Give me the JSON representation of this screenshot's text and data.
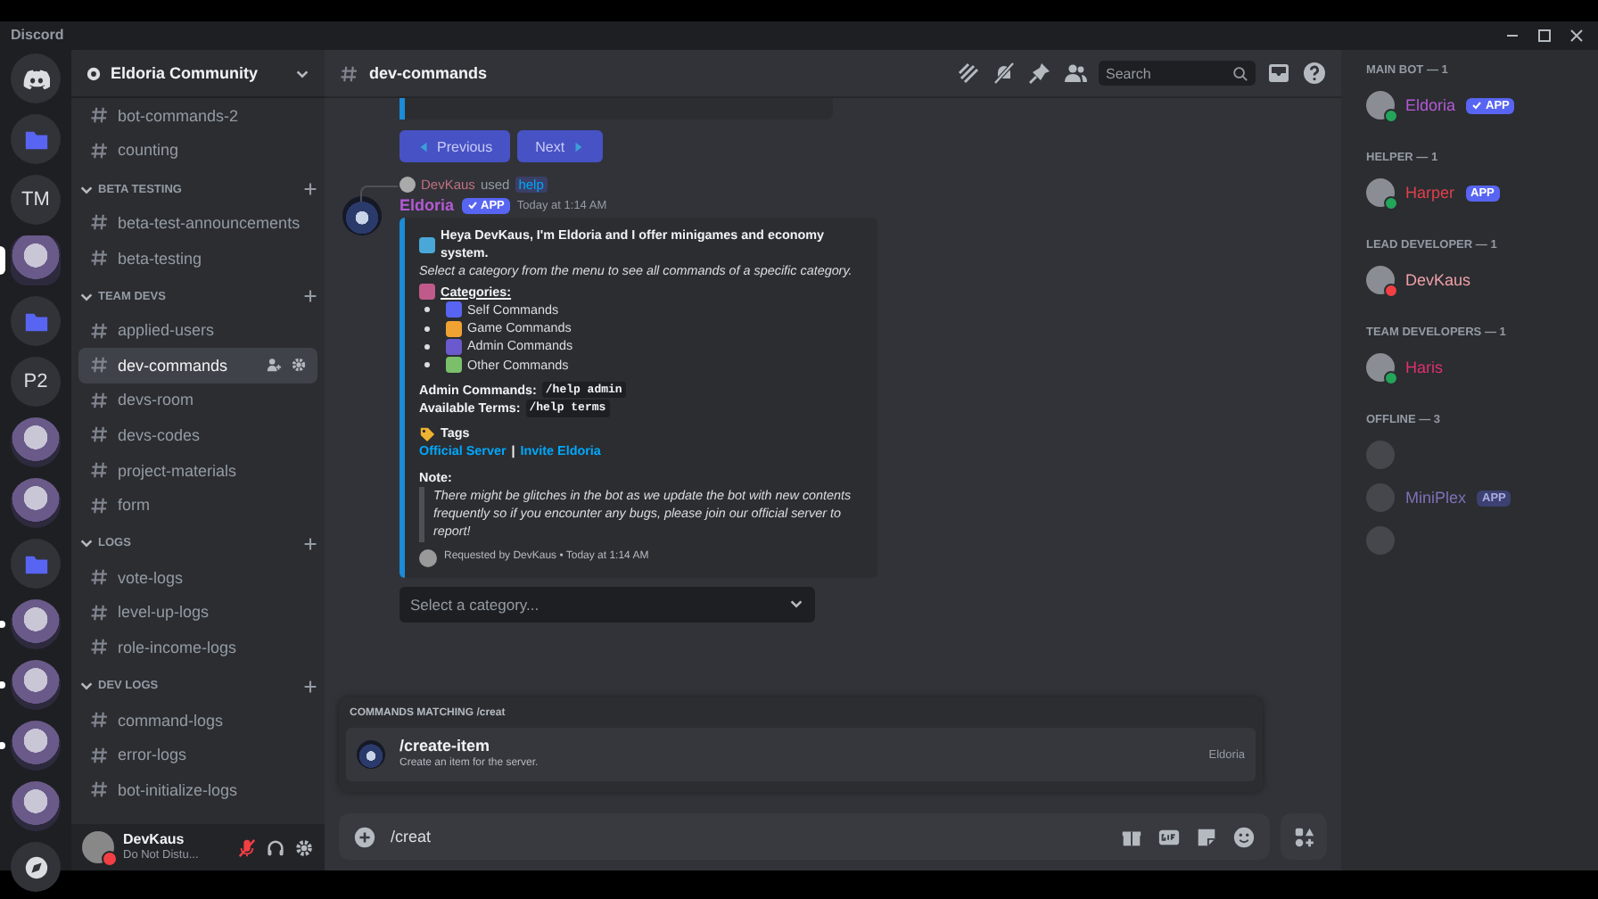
{
  "window": {
    "title": "Discord"
  },
  "servers": [
    {
      "kind": "home",
      "selected": false,
      "unread": false
    },
    {
      "kind": "folder",
      "selected": false,
      "unread": false
    },
    {
      "kind": "text",
      "label": "TM",
      "selected": false,
      "unread": false
    },
    {
      "kind": "avatar",
      "selected": true,
      "unread": false
    },
    {
      "kind": "folder",
      "selected": false,
      "unread": false
    },
    {
      "kind": "text",
      "label": "P2",
      "selected": false,
      "unread": false
    },
    {
      "kind": "avatar",
      "selected": false,
      "unread": false
    },
    {
      "kind": "avatar",
      "selected": false,
      "unread": false
    },
    {
      "kind": "folder",
      "selected": false,
      "unread": false
    },
    {
      "kind": "avatar",
      "selected": false,
      "unread": true
    },
    {
      "kind": "avatar",
      "selected": false,
      "unread": true
    },
    {
      "kind": "avatar",
      "selected": false,
      "unread": true
    },
    {
      "kind": "avatar",
      "selected": false,
      "unread": false
    },
    {
      "kind": "explore",
      "selected": false,
      "unread": false
    }
  ],
  "server": {
    "name": "Eldoria Community"
  },
  "channels": [
    {
      "kind": "channel",
      "name": "bot-commands-2",
      "selected": false
    },
    {
      "kind": "channel",
      "name": "counting",
      "selected": false
    },
    {
      "kind": "category",
      "name": "BETA TESTING",
      "children": [
        {
          "kind": "channel",
          "name": "beta-test-announcements",
          "selected": false
        },
        {
          "kind": "channel",
          "name": "beta-testing",
          "selected": false
        }
      ]
    },
    {
      "kind": "category",
      "name": "TEAM DEVS",
      "children": [
        {
          "kind": "channel",
          "name": "applied-users",
          "selected": false
        },
        {
          "kind": "channel",
          "name": "dev-commands",
          "selected": true
        },
        {
          "kind": "channel",
          "name": "devs-room",
          "selected": false
        },
        {
          "kind": "channel",
          "name": "devs-codes",
          "selected": false
        },
        {
          "kind": "channel",
          "name": "project-materials",
          "selected": false
        },
        {
          "kind": "channel",
          "name": "form",
          "selected": false
        }
      ]
    },
    {
      "kind": "category",
      "name": "LOGS",
      "children": [
        {
          "kind": "channel",
          "name": "vote-logs",
          "selected": false
        },
        {
          "kind": "channel",
          "name": "level-up-logs",
          "selected": false
        },
        {
          "kind": "channel",
          "name": "role-income-logs",
          "selected": false
        }
      ]
    },
    {
      "kind": "category",
      "name": "DEV LOGS",
      "children": [
        {
          "kind": "channel",
          "name": "command-logs",
          "selected": false
        },
        {
          "kind": "channel",
          "name": "error-logs",
          "selected": false
        },
        {
          "kind": "channel",
          "name": "bot-initialize-logs",
          "selected": false
        }
      ]
    }
  ],
  "user_panel": {
    "name": "DevKaus",
    "status": "Do Not Distu...",
    "muted": true
  },
  "header": {
    "channel": "dev-commands",
    "search_placeholder": "Search"
  },
  "pager": [
    "Previous",
    "Next"
  ],
  "message": {
    "used_by": "DevKaus",
    "used_word": "used",
    "command": "help",
    "author": "Eldoria",
    "badge": "APP",
    "time": "Today at 1:14 AM",
    "embed": {
      "intro": "Heya DevKaus, I'm Eldoria and I offer minigames and economy system.",
      "hint": "Select a category from the menu to see all commands of a specific category.",
      "categories_title": "Categories:",
      "categories": [
        {
          "label": "Self Commands",
          "color": "#5865f2"
        },
        {
          "label": "Game Commands",
          "color": "#f0a232"
        },
        {
          "label": "Admin Commands",
          "color": "#6a5acd"
        },
        {
          "label": "Other Commands",
          "color": "#7bbf6a"
        }
      ],
      "commands": [
        {
          "label": "Admin Commands:",
          "code": "/help admin"
        },
        {
          "label": "Available Terms:",
          "code": "/help terms"
        }
      ],
      "tags_title": "Tags",
      "links": [
        "Official Server",
        "Invite Eldoria"
      ],
      "link_separator": "|",
      "note_title": "Note:",
      "note": "There might be glitches in the bot as we update the bot with new contents frequently so if you encounter any bugs, please join our official server to report!",
      "footer": "Requested by DevKaus • Today at 1:14 AM"
    },
    "select_placeholder": "Select a category..."
  },
  "autocomplete": {
    "title": "COMMANDS MATCHING /creat",
    "items": [
      {
        "command": "/create-item",
        "description": "Create an item for the server.",
        "source": "Eldoria"
      }
    ]
  },
  "composer": {
    "value": "/creat"
  },
  "members": [
    {
      "title": "MAIN BOT — 1",
      "items": [
        {
          "name": "Eldoria",
          "color": "#b45ad6",
          "badge": "APP",
          "verified": true,
          "kind": "online"
        }
      ]
    },
    {
      "title": "HELPER — 1",
      "items": [
        {
          "name": "Harper",
          "color": "#e0404a",
          "badge": "APP",
          "verified": false,
          "kind": "online"
        }
      ]
    },
    {
      "title": "LEAD DEVELOPER — 1",
      "items": [
        {
          "name": "DevKaus",
          "color": "#f0a0a8",
          "kind": "dnd"
        }
      ]
    },
    {
      "title": "TEAM DEVELOPERS — 1",
      "items": [
        {
          "name": "Haris",
          "color": "#e0306a",
          "kind": "online"
        }
      ]
    },
    {
      "title": "OFFLINE — 3",
      "items": [
        {
          "kind": "offline"
        },
        {
          "name": "MiniPlex",
          "color": "#8070b8",
          "badge": "APP",
          "verified": false,
          "kind": "offline"
        },
        {
          "kind": "offline"
        }
      ]
    }
  ]
}
